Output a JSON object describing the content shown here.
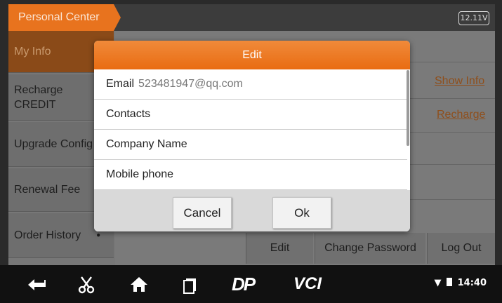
{
  "header": {
    "title": "Personal Center",
    "battery": "12.11V"
  },
  "sidebar": {
    "items": [
      {
        "label": "My Info"
      },
      {
        "label": "Recharge CREDIT"
      },
      {
        "label": "Upgrade Config"
      },
      {
        "label": "Renewal Fee"
      },
      {
        "label": "Order History"
      }
    ]
  },
  "main": {
    "show_info_link": "Show Info",
    "recharge_link": "Recharge",
    "buttons": {
      "edit": "Edit",
      "change_password": "Change Password",
      "log_out": "Log Out"
    }
  },
  "dialog": {
    "title": "Edit",
    "fields": [
      {
        "label": "Email",
        "value": "523481947@qq.com"
      },
      {
        "label": "Contacts",
        "value": ""
      },
      {
        "label": "Company Name",
        "value": ""
      },
      {
        "label": "Mobile phone",
        "value": ""
      }
    ],
    "cancel_label": "Cancel",
    "ok_label": "Ok"
  },
  "navbar": {
    "icons": [
      "back-icon",
      "scissors-icon",
      "home-icon",
      "recent-apps-icon",
      "dp-icon",
      "vci-icon"
    ],
    "dp_text": "DP",
    "vci_text": "VCI",
    "time": "14:40"
  },
  "colors": {
    "accent": "#e8731e",
    "navbar": "#111111"
  }
}
